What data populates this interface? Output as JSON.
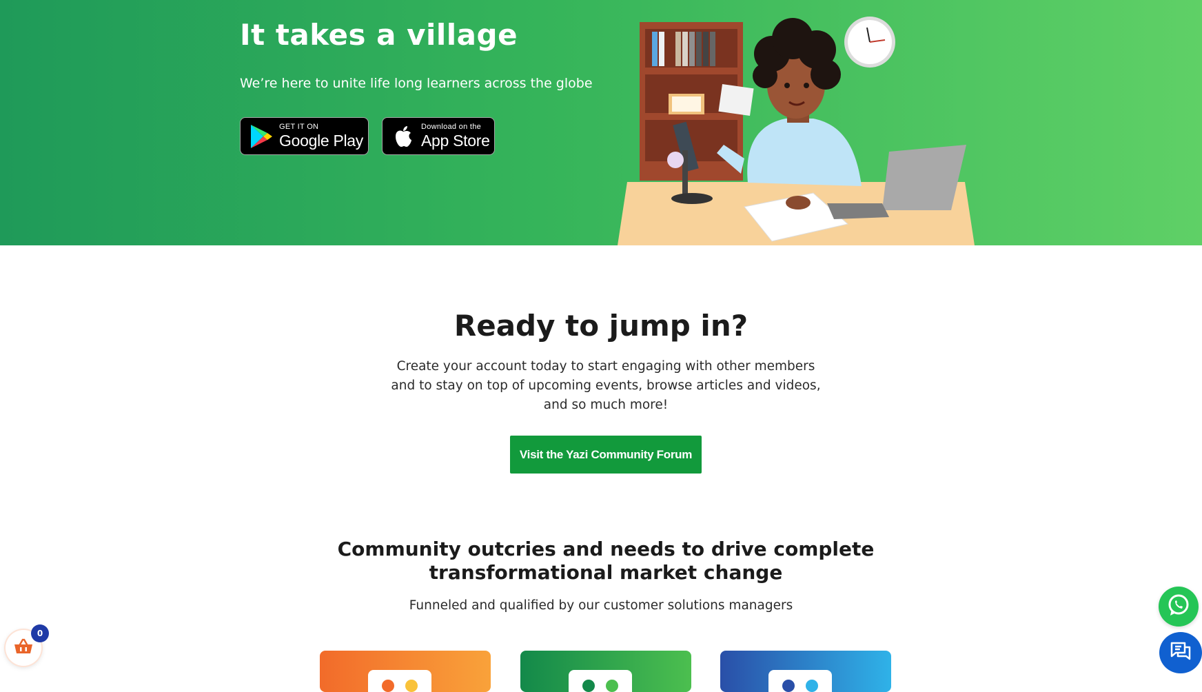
{
  "hero": {
    "title": "It takes a village",
    "subtitle": "We’re here to unite life long learners across the globe",
    "google_play": {
      "small": "GET IT ON",
      "big": "Google Play"
    },
    "app_store": {
      "small": "Download on the",
      "big": "App Store"
    }
  },
  "ready": {
    "title": "Ready to jump in?",
    "text": "Create your account today to start engaging with other members and to stay on top of upcoming events, browse articles and videos, and so much more!",
    "button": "Visit the Yazi Community Forum"
  },
  "community": {
    "title": "Community outcries and needs to drive complete transformational market change",
    "subtitle": "Funneled and qualified by our customer solutions managers"
  },
  "cart": {
    "count": "0"
  },
  "colors": {
    "hero_start": "#1f9a59",
    "hero_end": "#5fd066",
    "button": "#129a3c",
    "whatsapp": "#25c556",
    "chat": "#1060d0",
    "cart_badge": "#1f3aa6"
  }
}
